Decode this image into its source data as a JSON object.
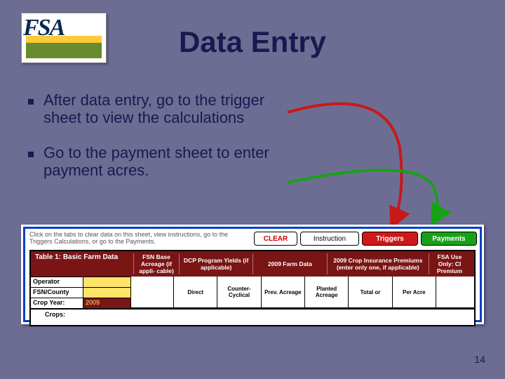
{
  "logo_text": "FSA",
  "title": "Data Entry",
  "bullets": [
    "After data entry, go to the trigger sheet to view the calculations",
    "Go to the payment sheet to enter payment acres."
  ],
  "slide_number": "14",
  "embed": {
    "hint": "Click on the tabs to clear data on this sheet, view instructions, go to the Triggers Calculations, or go to the Payments.",
    "tabs": {
      "clear": "CLEAR",
      "instruction": "Instruction",
      "triggers": "Triggers",
      "payments": "Payments"
    },
    "table1_title": "Table 1:  Basic Farm Data",
    "head_cols": [
      "FSN Base Acreage (if appli- cable)",
      "DCP Program Yields (if applicable)",
      "2009 Farm Data",
      "2009 Crop Insurance Premiums (enter only one, if applicable)",
      "FSA Use Only: CI Premium"
    ],
    "rows": {
      "operator": "Operator",
      "fsn": "FSN/County",
      "cropyear_k": "Crop Year:",
      "cropyear_v": "2009",
      "crops_k": "Crops:"
    },
    "subcols": {
      "direct": "Direct",
      "counter": "Counter- Cyclical",
      "prev": "Prev. Acreage",
      "planted": "Planted Acreage",
      "total": "Total   or",
      "peracre": "Per Acre"
    }
  }
}
